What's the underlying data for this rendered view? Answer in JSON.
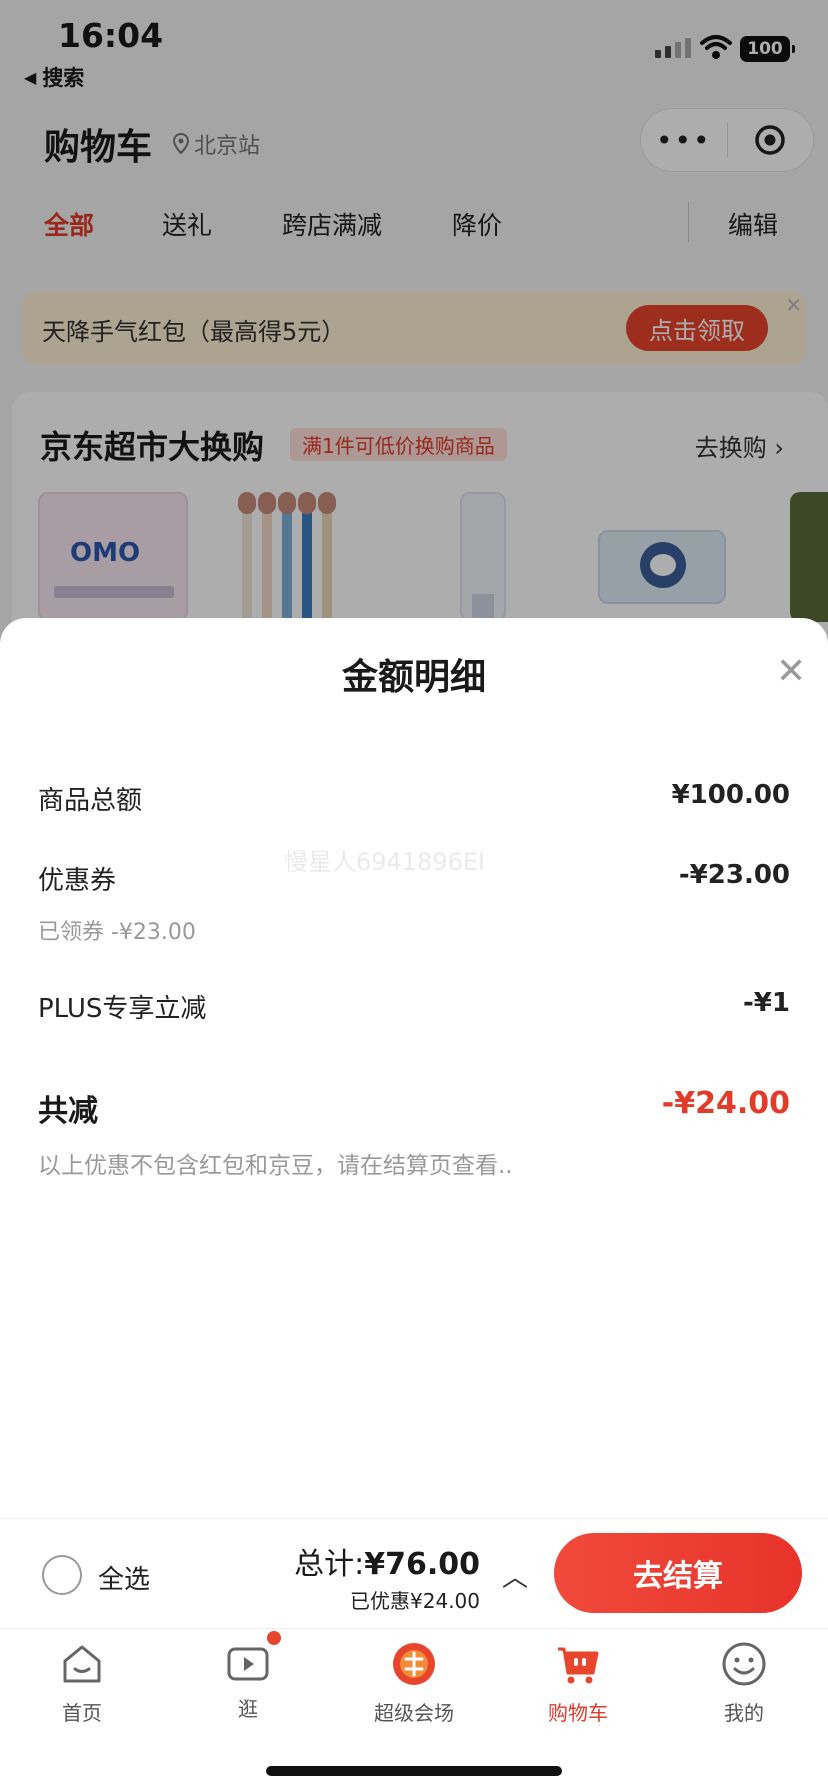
{
  "status": {
    "time": "16:04",
    "back_label": "搜索",
    "battery": "100"
  },
  "header": {
    "title": "购物车",
    "location": "北京站"
  },
  "tabs": [
    "全部",
    "送礼",
    "跨店满减",
    "降价"
  ],
  "edit_label": "编辑",
  "banner": {
    "text": "天降手气红包（最高得5元）",
    "button": "点击领取"
  },
  "promo": {
    "title": "京东超市大换购",
    "tag": "满1件可低价换购商品",
    "link": "去换购 ›",
    "product_label": "OMO"
  },
  "sheet": {
    "title": "金额明细",
    "rows": [
      {
        "label": "商品总额",
        "value": "¥100.00"
      },
      {
        "label": "优惠券",
        "value": "-¥23.00",
        "sub": "已领券 -¥23.00"
      },
      {
        "label": "PLUS专享立减",
        "value": "-¥1"
      }
    ],
    "total_label": "共减",
    "total_value": "-¥24.00",
    "note": "以上优惠不包含红包和京豆，请在结算页查看..",
    "watermark": "慢星人6941896EI"
  },
  "checkout": {
    "select_all": "全选",
    "total_label": "总计:",
    "total_value": "¥76.00",
    "saved": "已优惠¥24.00",
    "button": "去结算"
  },
  "tabbar": [
    {
      "label": "首页",
      "icon": "home-icon"
    },
    {
      "label": "逛",
      "icon": "video-icon"
    },
    {
      "label": "超级会场",
      "icon": "venue-icon"
    },
    {
      "label": "购物车",
      "icon": "cart-icon"
    },
    {
      "label": "我的",
      "icon": "profile-icon"
    }
  ],
  "colors": {
    "accent": "#e23b2a",
    "banner_bg": "#fff1d6",
    "button": "#e8452d"
  }
}
